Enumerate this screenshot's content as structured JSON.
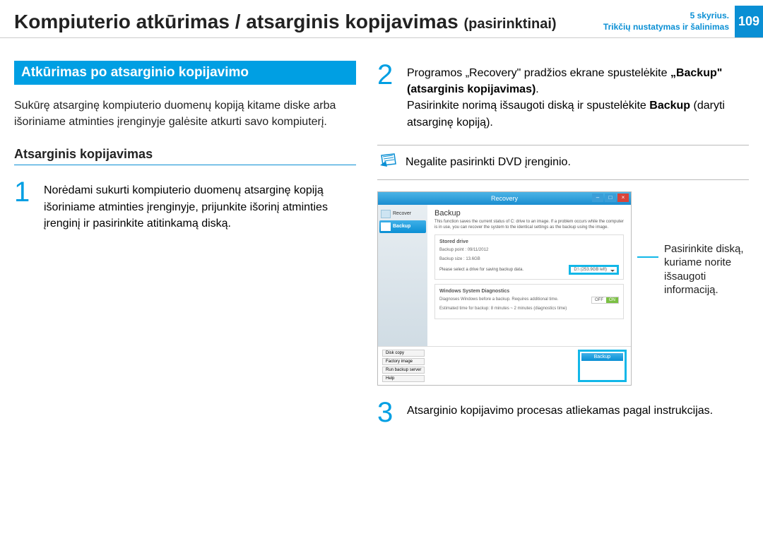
{
  "header": {
    "title_main": "Kompiuterio atkūrimas / atsarginis kopijavimas",
    "title_sub": "(pasirinktinai)",
    "chapter_line1": "5 skyrius.",
    "chapter_line2": "Trikčių nustatymas ir šalinimas",
    "page_number": "109"
  },
  "left": {
    "section_heading": "Atkūrimas po atsarginio kopijavimo",
    "intro": "Sukūrę atsarginę kompiuterio duomenų kopiją kitame diske arba išoriniame atminties įrenginyje galėsite atkurti savo kompiuterį.",
    "subhead": "Atsarginis kopijavimas",
    "step1": "Norėdami sukurti kompiuterio duomenų atsarginę kopiją išoriniame atminties įrenginyje, prijunkite išorinį atminties įrenginį ir pasirinkite atitinkamą diską."
  },
  "right": {
    "step2_a": "Programos „Recovery\" pradžios ekrane spustelėkite ",
    "step2_b": "„Backup\" (atsarginis kopijavimas)",
    "step2_c": ".",
    "step2_d": "Pasirinkite norimą išsaugoti diską ir spustelėkite ",
    "step2_e": "Backup",
    "step2_f": " (daryti atsarginę kopiją).",
    "note": "Negalite pasirinkti DVD įrenginio.",
    "callout": "Pasirinkite diską, kuriame norite išsaugoti informaciją.",
    "step3": "Atsarginio kopijavimo procesas atliekamas pagal instrukcijas."
  },
  "app": {
    "title": "Recovery",
    "sidebar": {
      "recover": "Recover",
      "backup": "Backup"
    },
    "main_title": "Backup",
    "desc": "This function saves the current status of C: drive to an image. If a problem occurs while the computer is in use, you can recover the system to the identical settings as the backup using the image.",
    "panel1_title": "Stored drive",
    "meta1": "Backup point : 09/11/2012",
    "meta2": "Backup size : 13.6GB",
    "drive_label": "Please select a drive for saving backup data.",
    "drive_value": "D:\\ (253.9GB left)",
    "panel2_title": "Windows System Diagnostics",
    "diag_text": "Diagnoses Windows before a backup. Requires additional time.",
    "diag_time": "Estimated time for backup: 8 minutes ~ 2 minutes (diagnostics time)",
    "off": "OFF",
    "on": "ON",
    "foot_disk": "Disk copy",
    "foot_factory": "Factory image",
    "foot_server": "Run backup server",
    "foot_help": "Help",
    "backup_btn": "Backup"
  }
}
